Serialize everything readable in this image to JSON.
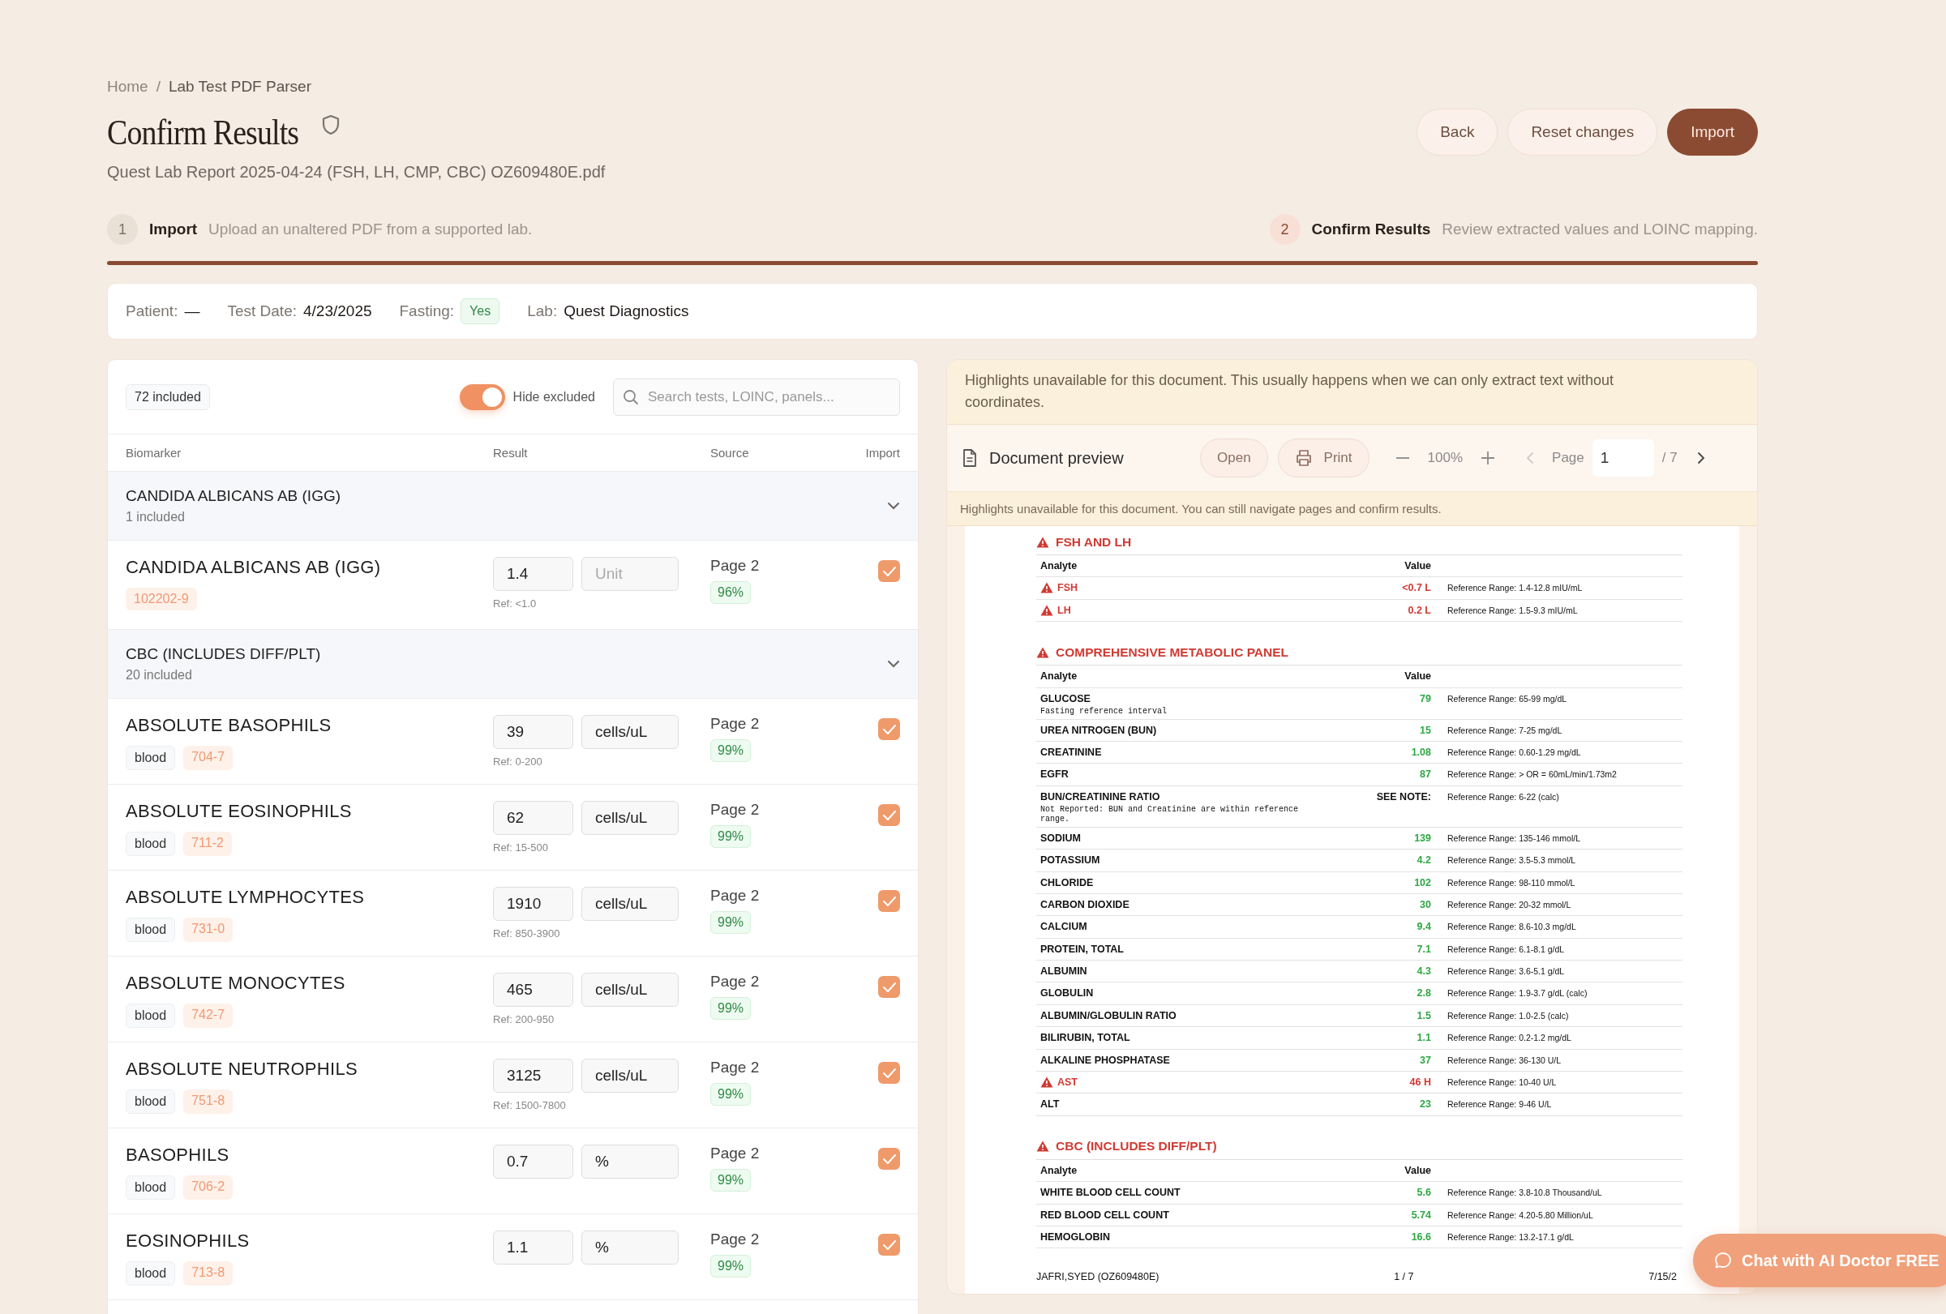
{
  "breadcrumb": {
    "items": [
      "Home",
      "Lab Test PDF Parser"
    ],
    "separator": "/"
  },
  "title": "Confirm Results",
  "file_name": "Quest Lab Report 2025-04-24 (FSH, LH, CMP, CBC) OZ609480E.pdf",
  "actions": [
    {
      "label": "Back",
      "kind": "secondary"
    },
    {
      "label": "Reset changes",
      "kind": "secondary"
    },
    {
      "label": "Import",
      "kind": "primary"
    }
  ],
  "steps": [
    {
      "number": "1",
      "label": "Import",
      "description": "Upload an unaltered PDF from a supported lab.",
      "selected": false
    },
    {
      "number": "2",
      "label": "Confirm Results",
      "description": "Review extracted values and LOINC mapping.",
      "selected": true
    }
  ],
  "info": [
    {
      "label": "Patient:",
      "value": "—",
      "kind": "text"
    },
    {
      "label": "Test Date:",
      "value": "4/23/2025",
      "kind": "text"
    },
    {
      "label": "Fasting:",
      "value": "Yes",
      "kind": "badge"
    },
    {
      "label": "Lab:",
      "value": "Quest Diagnostics",
      "kind": "text"
    }
  ],
  "results": {
    "count": "72 included",
    "hide_excluded": {
      "label": "Hide excluded",
      "on": true
    },
    "search": {
      "placeholder": "Search tests, LOINC, panels..."
    },
    "columns": [
      "Biomarker",
      "Result",
      "Source",
      "Import"
    ],
    "rows": [
      {
        "kind": "group",
        "name": "CANDIDA ALBICANS AB (IGG)",
        "count": "1 included",
        "expanded": true
      },
      {
        "kind": "item",
        "name": "CANDIDA ALBICANS AB (IGG)",
        "tags": [
          {
            "kind": "loinc",
            "text": "102202-9"
          }
        ],
        "value": "1.4",
        "unit_placeholder": "Unit",
        "ref": "Ref: <1.0",
        "source": "Page 2",
        "confidence": "96%",
        "checked": true
      },
      {
        "kind": "group",
        "name": "CBC (INCLUDES DIFF/PLT)",
        "count": "20 included",
        "expanded": true
      },
      {
        "kind": "item",
        "name": "ABSOLUTE BASOPHILS",
        "tags": [
          {
            "kind": "specimen",
            "text": "blood"
          },
          {
            "kind": "loinc",
            "text": "704-7"
          }
        ],
        "value": "39",
        "unit": "cells/uL",
        "ref": "Ref: 0-200",
        "source": "Page 2",
        "confidence": "99%",
        "checked": true
      },
      {
        "kind": "item",
        "name": "ABSOLUTE EOSINOPHILS",
        "tags": [
          {
            "kind": "specimen",
            "text": "blood"
          },
          {
            "kind": "loinc",
            "text": "711-2"
          }
        ],
        "value": "62",
        "unit": "cells/uL",
        "ref": "Ref: 15-500",
        "source": "Page 2",
        "confidence": "99%",
        "checked": true
      },
      {
        "kind": "item",
        "name": "ABSOLUTE LYMPHOCYTES",
        "tags": [
          {
            "kind": "specimen",
            "text": "blood"
          },
          {
            "kind": "loinc",
            "text": "731-0"
          }
        ],
        "value": "1910",
        "unit": "cells/uL",
        "ref": "Ref: 850-3900",
        "source": "Page 2",
        "confidence": "99%",
        "checked": true
      },
      {
        "kind": "item",
        "name": "ABSOLUTE MONOCYTES",
        "tags": [
          {
            "kind": "specimen",
            "text": "blood"
          },
          {
            "kind": "loinc",
            "text": "742-7"
          }
        ],
        "value": "465",
        "unit": "cells/uL",
        "ref": "Ref: 200-950",
        "source": "Page 2",
        "confidence": "99%",
        "checked": true
      },
      {
        "kind": "item",
        "name": "ABSOLUTE NEUTROPHILS",
        "tags": [
          {
            "kind": "specimen",
            "text": "blood"
          },
          {
            "kind": "loinc",
            "text": "751-8"
          }
        ],
        "value": "3125",
        "unit": "cells/uL",
        "ref": "Ref: 1500-7800",
        "source": "Page 2",
        "confidence": "99%",
        "checked": true
      },
      {
        "kind": "item",
        "name": "BASOPHILS",
        "tags": [
          {
            "kind": "specimen",
            "text": "blood"
          },
          {
            "kind": "loinc",
            "text": "706-2"
          }
        ],
        "value": "0.7",
        "unit": "%",
        "source": "Page 2",
        "confidence": "99%",
        "checked": true
      },
      {
        "kind": "item",
        "name": "EOSINOPHILS",
        "tags": [
          {
            "kind": "specimen",
            "text": "blood"
          },
          {
            "kind": "loinc",
            "text": "713-8"
          }
        ],
        "value": "1.1",
        "unit": "%",
        "source": "Page 2",
        "confidence": "99%",
        "checked": true
      }
    ]
  },
  "preview": {
    "notice": "Highlights unavailable for this document. This usually happens when we can only extract text without coordinates.",
    "title": "Document preview",
    "open_label": "Open",
    "print_label": "Print",
    "zoom": "100%",
    "pager": {
      "label": "Page",
      "value": "1",
      "total": "/ 7",
      "prev_disabled": true,
      "next_disabled": false
    },
    "note": "Highlights unavailable for this document. You can still navigate pages and confirm results.",
    "sections": [
      {
        "title": "FSH AND LH",
        "flagged": true,
        "columns": [
          "Analyte",
          "Value"
        ],
        "rows": [
          {
            "kind": "result",
            "name": "FSH",
            "value": "<0.7 L",
            "abnormal": true,
            "reference": "Reference Range: 1.4-12.8 mIU/mL"
          },
          {
            "kind": "result",
            "name": "LH",
            "value": "0.2 L",
            "abnormal": true,
            "reference": "Reference Range: 1.5-9.3 mIU/mL"
          }
        ]
      },
      {
        "title": "COMPREHENSIVE METABOLIC PANEL",
        "flagged": true,
        "columns": [
          "Analyte",
          "Value"
        ],
        "rows": [
          {
            "kind": "result",
            "name": "GLUCOSE",
            "value": "79",
            "abnormal": false,
            "reference": "Reference Range: 65-99 mg/dL",
            "note": "Fasting reference interval"
          },
          {
            "kind": "result",
            "name": "UREA NITROGEN (BUN)",
            "value": "15",
            "abnormal": false,
            "reference": "Reference Range: 7-25 mg/dL"
          },
          {
            "kind": "result",
            "name": "CREATININE",
            "value": "1.08",
            "abnormal": false,
            "reference": "Reference Range: 0.60-1.29 mg/dL"
          },
          {
            "kind": "result",
            "name": "EGFR",
            "value": "87",
            "abnormal": false,
            "reference": "Reference Range: > OR = 60mL/min/1.73m2"
          },
          {
            "kind": "note",
            "name": "BUN/CREATININE RATIO",
            "value": "SEE NOTE:",
            "abnormal": false,
            "reference": "Reference Range: 6-22 (calc)",
            "note": "Not Reported: BUN and Creatinine are within reference range."
          },
          {
            "kind": "result",
            "name": "SODIUM",
            "value": "139",
            "abnormal": false,
            "reference": "Reference Range: 135-146 mmol/L"
          },
          {
            "kind": "result",
            "name": "POTASSIUM",
            "value": "4.2",
            "abnormal": false,
            "reference": "Reference Range: 3.5-5.3 mmol/L"
          },
          {
            "kind": "result",
            "name": "CHLORIDE",
            "value": "102",
            "abnormal": false,
            "reference": "Reference Range: 98-110 mmol/L"
          },
          {
            "kind": "result",
            "name": "CARBON DIOXIDE",
            "value": "30",
            "abnormal": false,
            "reference": "Reference Range: 20-32 mmol/L"
          },
          {
            "kind": "result",
            "name": "CALCIUM",
            "value": "9.4",
            "abnormal": false,
            "reference": "Reference Range: 8.6-10.3 mg/dL"
          },
          {
            "kind": "result",
            "name": "PROTEIN, TOTAL",
            "value": "7.1",
            "abnormal": false,
            "reference": "Reference Range: 6.1-8.1 g/dL"
          },
          {
            "kind": "result",
            "name": "ALBUMIN",
            "value": "4.3",
            "abnormal": false,
            "reference": "Reference Range: 3.6-5.1 g/dL"
          },
          {
            "kind": "result",
            "name": "GLOBULIN",
            "value": "2.8",
            "abnormal": false,
            "reference": "Reference Range: 1.9-3.7 g/dL (calc)"
          },
          {
            "kind": "result",
            "name": "ALBUMIN/GLOBULIN RATIO",
            "value": "1.5",
            "abnormal": false,
            "reference": "Reference Range: 1.0-2.5 (calc)"
          },
          {
            "kind": "result",
            "name": "BILIRUBIN, TOTAL",
            "value": "1.1",
            "abnormal": false,
            "reference": "Reference Range: 0.2-1.2 mg/dL"
          },
          {
            "kind": "result",
            "name": "ALKALINE PHOSPHATASE",
            "value": "37",
            "abnormal": false,
            "reference": "Reference Range: 36-130 U/L"
          },
          {
            "kind": "result",
            "name": "AST",
            "value": "46 H",
            "abnormal": true,
            "reference": "Reference Range: 10-40 U/L"
          },
          {
            "kind": "result",
            "name": "ALT",
            "value": "23",
            "abnormal": false,
            "reference": "Reference Range: 9-46 U/L"
          }
        ]
      },
      {
        "title": "CBC (INCLUDES DIFF/PLT)",
        "flagged": true,
        "columns": [
          "Analyte",
          "Value"
        ],
        "rows": [
          {
            "kind": "result",
            "name": "WHITE BLOOD CELL COUNT",
            "value": "5.6",
            "abnormal": false,
            "reference": "Reference Range: 3.8-10.8 Thousand/uL"
          },
          {
            "kind": "result",
            "name": "RED BLOOD CELL COUNT",
            "value": "5.74",
            "abnormal": false,
            "reference": "Reference Range: 4.20-5.80 Million/uL"
          },
          {
            "kind": "result",
            "name": "HEMOGLOBIN",
            "value": "16.6",
            "abnormal": false,
            "reference": "Reference Range: 13.2-17.1 g/dL"
          }
        ]
      }
    ],
    "footer": {
      "patient": "JAFRI,SYED (OZ609480E)",
      "page": "1 / 7",
      "date": "7/15/2"
    }
  },
  "chat": {
    "label": "Chat with AI Doctor FREE"
  }
}
